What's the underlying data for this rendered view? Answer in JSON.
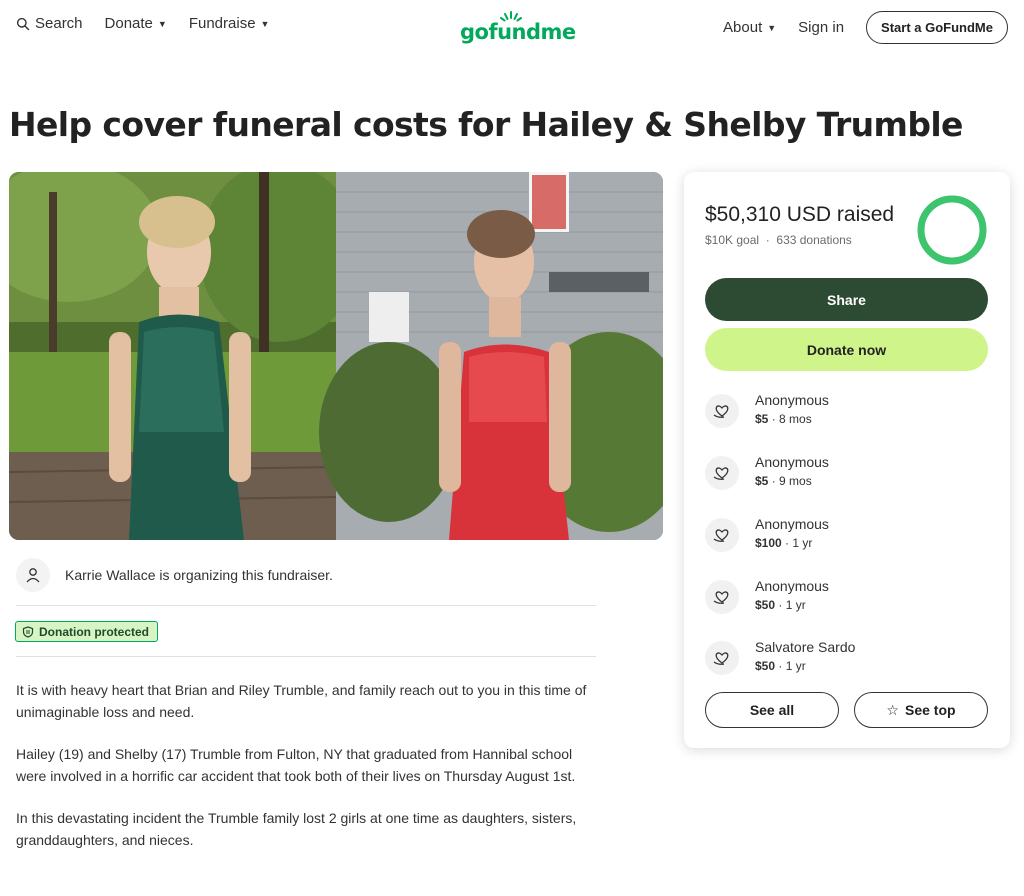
{
  "header": {
    "search_label": "Search",
    "donate_label": "Donate",
    "fundraise_label": "Fundraise",
    "logo_text": "gofundme",
    "about_label": "About",
    "signin_label": "Sign in",
    "start_label": "Start a GoFundMe"
  },
  "page": {
    "title": "Help cover funeral costs for Hailey & Shelby Trumble"
  },
  "organizer": {
    "text": "Karrie Wallace is organizing this fundraiser."
  },
  "badge": {
    "label": "Donation protected"
  },
  "story": [
    "It is with heavy heart that Brian and Riley Trumble, and family reach out to you in this time of unimaginable loss and need.",
    "Hailey (19) and Shelby (17) Trumble from Fulton, NY that graduated from Hannibal school were involved in a horrific car accident that took both of their lives on Thursday August 1st.",
    "In this devastating incident the Trumble family lost 2 girls at one time as daughters, sisters, granddaughters, and nieces."
  ],
  "sidebar": {
    "raised": "$50,310 USD raised",
    "goal": "$10K goal",
    "donations": "633 donations",
    "progress_fraction": 1.0,
    "share_label": "Share",
    "donate_label": "Donate now",
    "donors": [
      {
        "name": "Anonymous",
        "amount": "$5",
        "time": "8 mos"
      },
      {
        "name": "Anonymous",
        "amount": "$5",
        "time": "9 mos"
      },
      {
        "name": "Anonymous",
        "amount": "$100",
        "time": "1 yr"
      },
      {
        "name": "Anonymous",
        "amount": "$50",
        "time": "1 yr"
      },
      {
        "name": "Salvatore Sardo",
        "amount": "$50",
        "time": "1 yr"
      }
    ],
    "see_all_label": "See all",
    "see_top_label": "See top"
  },
  "colors": {
    "brand_green": "#02a95c",
    "share_button": "#2d4a33",
    "donate_button": "#cff58a",
    "badge_bg": "#d7f5c4"
  },
  "icons": [
    "search-icon",
    "chevron-down-icon",
    "logo-sun-icon",
    "user-icon",
    "shield-icon",
    "heart-hand-icon",
    "star-icon"
  ]
}
